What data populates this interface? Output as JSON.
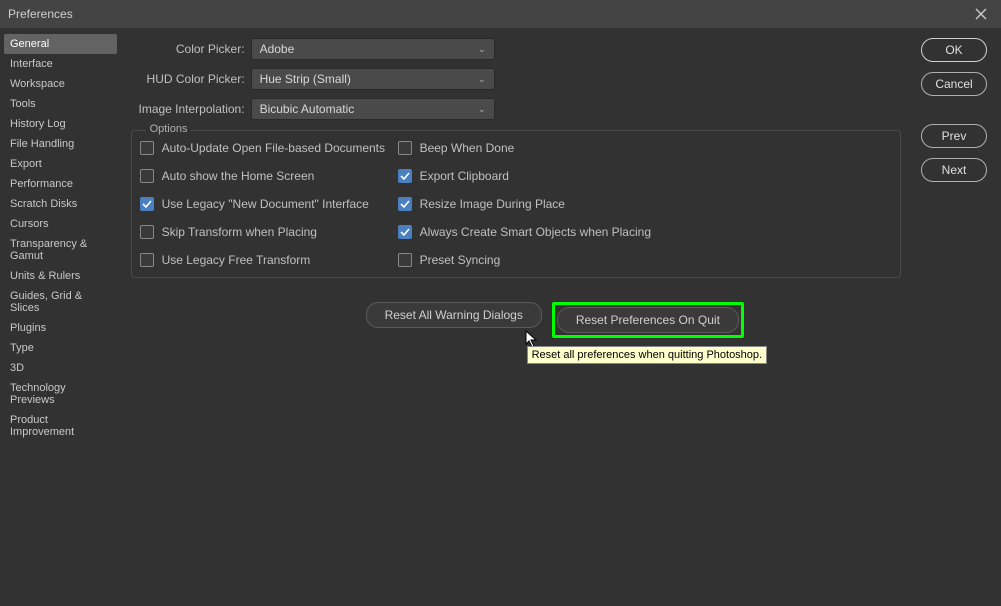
{
  "window": {
    "title": "Preferences"
  },
  "sidebar": {
    "items": [
      {
        "label": "General",
        "active": true
      },
      {
        "label": "Interface",
        "active": false
      },
      {
        "label": "Workspace",
        "active": false
      },
      {
        "label": "Tools",
        "active": false
      },
      {
        "label": "History Log",
        "active": false
      },
      {
        "label": "File Handling",
        "active": false
      },
      {
        "label": "Export",
        "active": false
      },
      {
        "label": "Performance",
        "active": false
      },
      {
        "label": "Scratch Disks",
        "active": false
      },
      {
        "label": "Cursors",
        "active": false
      },
      {
        "label": "Transparency & Gamut",
        "active": false
      },
      {
        "label": "Units & Rulers",
        "active": false
      },
      {
        "label": "Guides, Grid & Slices",
        "active": false
      },
      {
        "label": "Plugins",
        "active": false
      },
      {
        "label": "Type",
        "active": false
      },
      {
        "label": "3D",
        "active": false
      },
      {
        "label": "Technology Previews",
        "active": false
      },
      {
        "label": "Product Improvement",
        "active": false
      }
    ]
  },
  "form": {
    "color_picker": {
      "label": "Color Picker:",
      "value": "Adobe"
    },
    "hud_color_picker": {
      "label": "HUD Color Picker:",
      "value": "Hue Strip (Small)"
    },
    "image_interpolation": {
      "label": "Image Interpolation:",
      "value": "Bicubic Automatic"
    }
  },
  "options": {
    "legend": "Options",
    "left": [
      {
        "label": "Auto-Update Open File-based Documents",
        "checked": false
      },
      {
        "label": "Auto show the Home Screen",
        "checked": false
      },
      {
        "label": "Use Legacy \"New Document\" Interface",
        "checked": true
      },
      {
        "label": "Skip Transform when Placing",
        "checked": false
      },
      {
        "label": "Use Legacy Free Transform",
        "checked": false
      }
    ],
    "right": [
      {
        "label": "Beep When Done",
        "checked": false
      },
      {
        "label": "Export Clipboard",
        "checked": true
      },
      {
        "label": "Resize Image During Place",
        "checked": true
      },
      {
        "label": "Always Create Smart Objects when Placing",
        "checked": true
      },
      {
        "label": "Preset Syncing",
        "checked": false
      }
    ]
  },
  "buttons": {
    "reset_warnings": "Reset All Warning Dialogs",
    "reset_prefs": "Reset Preferences On Quit"
  },
  "tooltip": {
    "text": "Reset all preferences when quitting Photoshop."
  },
  "panel": {
    "ok": "OK",
    "cancel": "Cancel",
    "prev": "Prev",
    "next": "Next"
  }
}
